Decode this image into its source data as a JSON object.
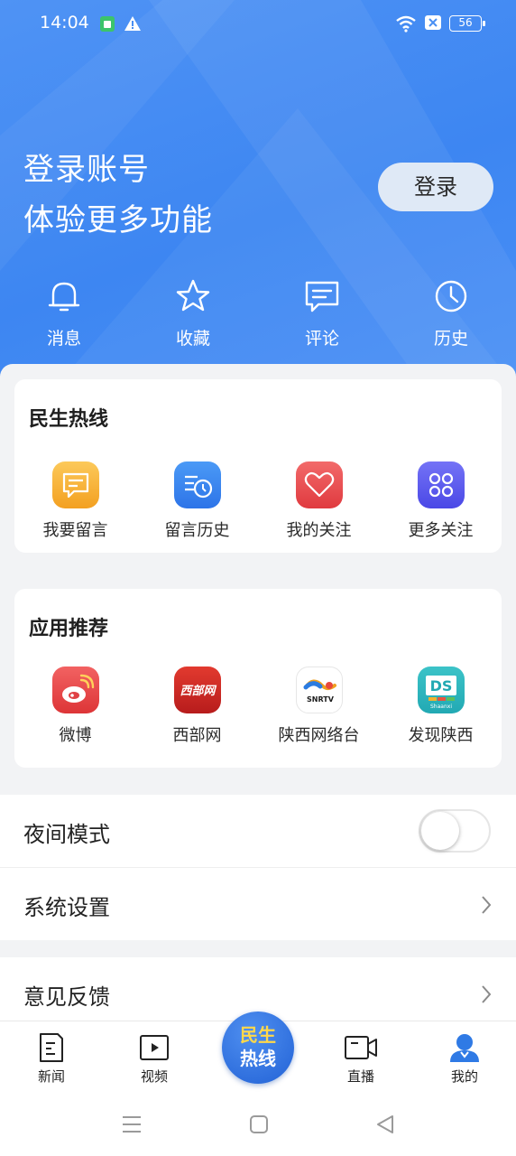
{
  "status_bar": {
    "time": "14:04",
    "battery": "56"
  },
  "header": {
    "promo_line1": "登录账号",
    "promo_line2": "体验更多功能",
    "login_label": "登录",
    "quick_links": [
      {
        "label": "消息",
        "icon": "bell-icon"
      },
      {
        "label": "收藏",
        "icon": "star-icon"
      },
      {
        "label": "评论",
        "icon": "comment-icon"
      },
      {
        "label": "历史",
        "icon": "clock-icon"
      }
    ]
  },
  "hotline": {
    "title": "民生热线",
    "items": [
      {
        "label": "我要留言",
        "icon": "message-icon",
        "color": "#f6b23c"
      },
      {
        "label": "留言历史",
        "icon": "list-clock-icon",
        "color": "#3a86f0"
      },
      {
        "label": "我的关注",
        "icon": "heart-icon",
        "color": "#ea4b4f"
      },
      {
        "label": "更多关注",
        "icon": "grid-icon",
        "color": "#5b5cf0"
      }
    ]
  },
  "apps": {
    "title": "应用推荐",
    "items": [
      {
        "label": "微博",
        "icon": "weibo-icon",
        "logo_text": ""
      },
      {
        "label": "西部网",
        "icon": "xibuwang-logo",
        "logo_text": "西部网"
      },
      {
        "label": "陕西网络台",
        "icon": "snrtv-logo",
        "logo_text": "SNRTV"
      },
      {
        "label": "发现陕西",
        "icon": "discover-shaanxi-logo",
        "logo_text": "Shaanxi"
      }
    ]
  },
  "settings": {
    "night_mode_label": "夜间模式",
    "night_mode_on": false,
    "system_settings_label": "系统设置",
    "feedback_label": "意见反馈"
  },
  "tabbar": {
    "tabs": [
      {
        "label": "新闻",
        "icon": "news-icon"
      },
      {
        "label": "视频",
        "icon": "video-icon"
      },
      {
        "label": "直播",
        "icon": "live-camera-icon"
      },
      {
        "label": "我的",
        "icon": "profile-icon"
      }
    ],
    "center_line1": "民生",
    "center_line2": "热线"
  }
}
